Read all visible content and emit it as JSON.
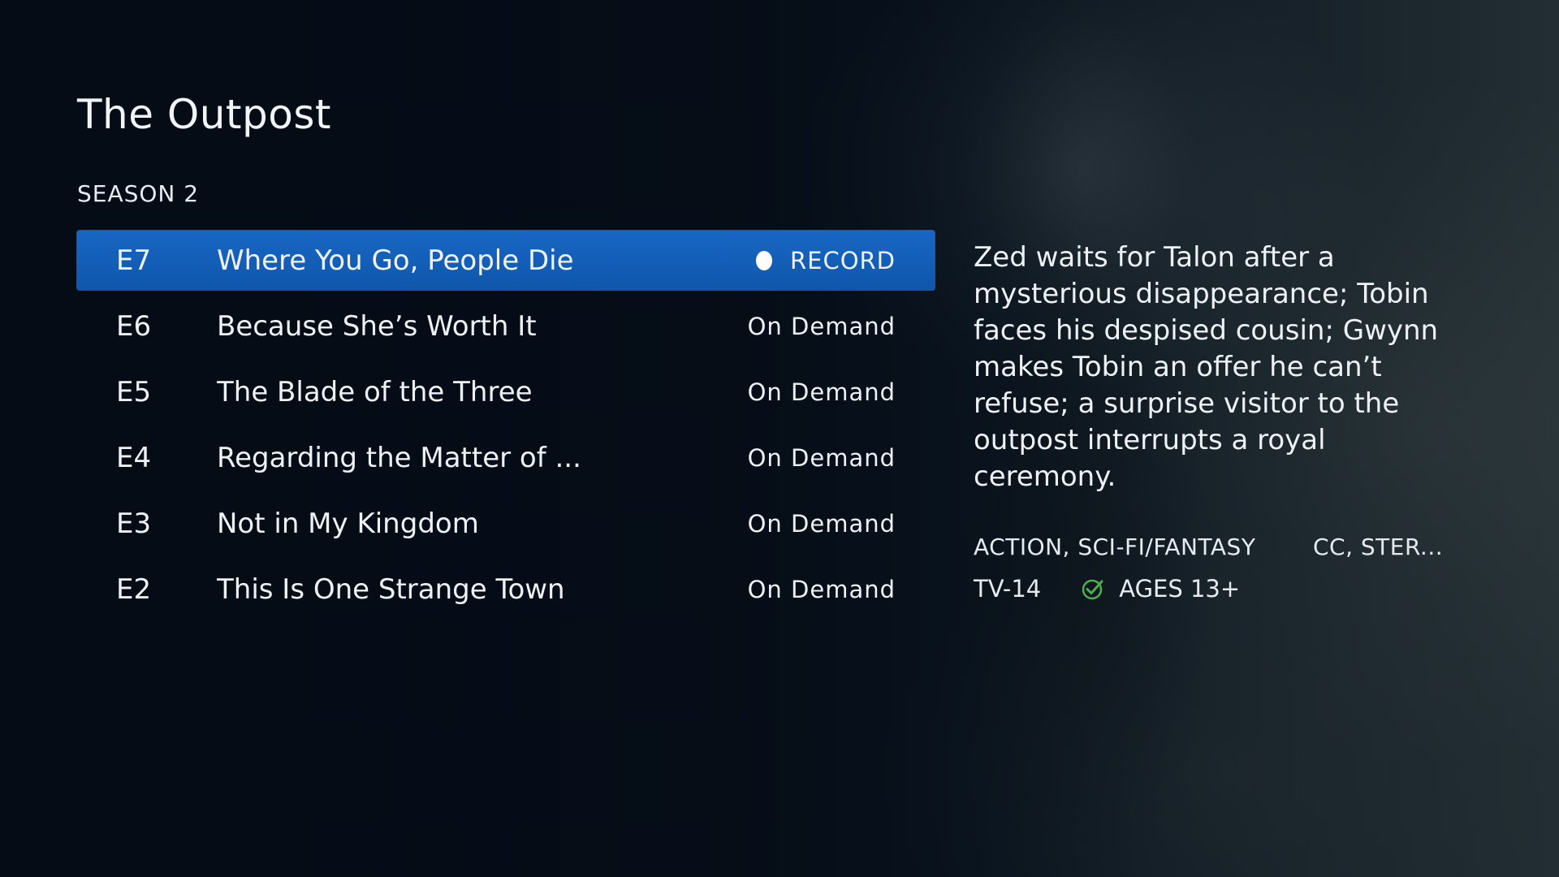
{
  "show": {
    "title": "The Outpost",
    "season_label": "SEASON 2"
  },
  "episodes": [
    {
      "number": "E7",
      "title": "Where You Go, People Die",
      "status": "RECORD",
      "selected": true
    },
    {
      "number": "E6",
      "title": "Because She’s Worth It",
      "status": "On Demand",
      "selected": false
    },
    {
      "number": "E5",
      "title": "The Blade of the Three",
      "status": "On Demand",
      "selected": false
    },
    {
      "number": "E4",
      "title": "Regarding the Matter of ...",
      "status": "On Demand",
      "selected": false
    },
    {
      "number": "E3",
      "title": "Not in My Kingdom",
      "status": "On Demand",
      "selected": false
    },
    {
      "number": "E2",
      "title": "This Is One Strange Town",
      "status": "On Demand",
      "selected": false
    }
  ],
  "details": {
    "description": "Zed waits for Talon after a mysterious disappearance; Tobin faces his despised cousin; Gwynn makes Tobin an offer he can’t refuse; a surprise visitor to the outpost interrupts a royal ceremony.",
    "genres": "ACTION, SCI-FI/FANTASY",
    "features": "CC, STER...",
    "rating": "TV-14",
    "age_label": "AGES 13+"
  },
  "icons": {
    "record": "record-dot-icon",
    "age_check": "check-circle-icon"
  },
  "colors": {
    "selected_row": "#1563bd",
    "check_icon": "#4caf50"
  }
}
